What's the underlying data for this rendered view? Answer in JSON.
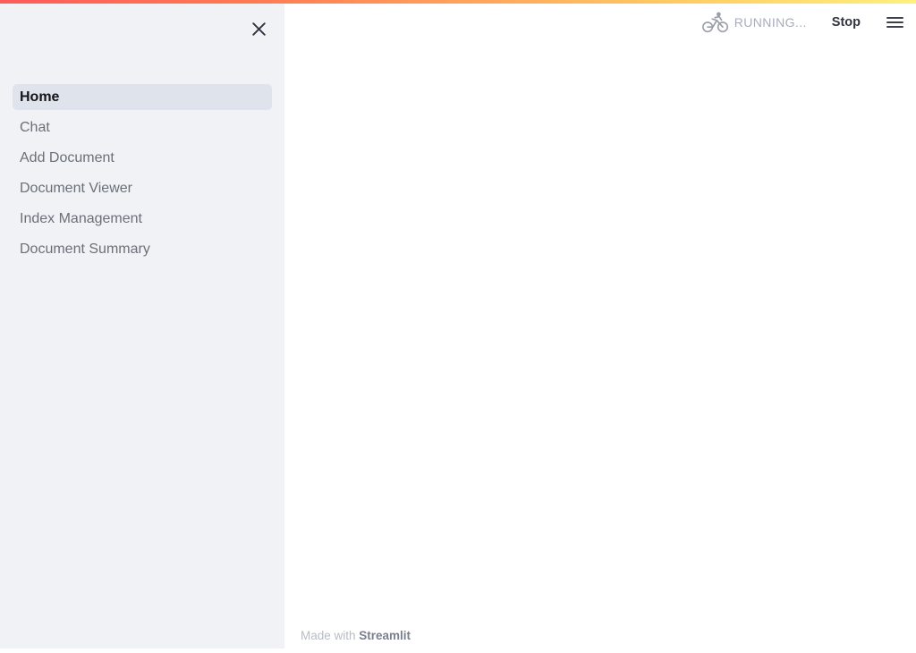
{
  "theme": {
    "gradient_start": "#ff5b5b",
    "gradient_mid": "#ffa15c",
    "gradient_end": "#fff07a",
    "sidebar_bg": "#f0f2f6",
    "main_bg": "#ffffff",
    "active_item_bg": "#dfe3eb",
    "nav_text": "#6b7078",
    "running_text": "#a8adbd"
  },
  "sidebar": {
    "close_label": "close-sidebar",
    "close_icon": "close-icon",
    "items": [
      {
        "label": "Home",
        "active": true
      },
      {
        "label": "Chat",
        "active": false
      },
      {
        "label": "Add Document",
        "active": false
      },
      {
        "label": "Document Viewer",
        "active": false
      },
      {
        "label": "Index Management",
        "active": false
      },
      {
        "label": "Document Summary",
        "active": false
      }
    ]
  },
  "toolbar": {
    "running_icon": "cyclist-icon",
    "running_label": "RUNNING...",
    "stop_label": "Stop",
    "menu_icon": "hamburger-menu-icon"
  },
  "main": {
    "content": ""
  },
  "footer": {
    "made_with": "Made with ",
    "brand": "Streamlit"
  }
}
